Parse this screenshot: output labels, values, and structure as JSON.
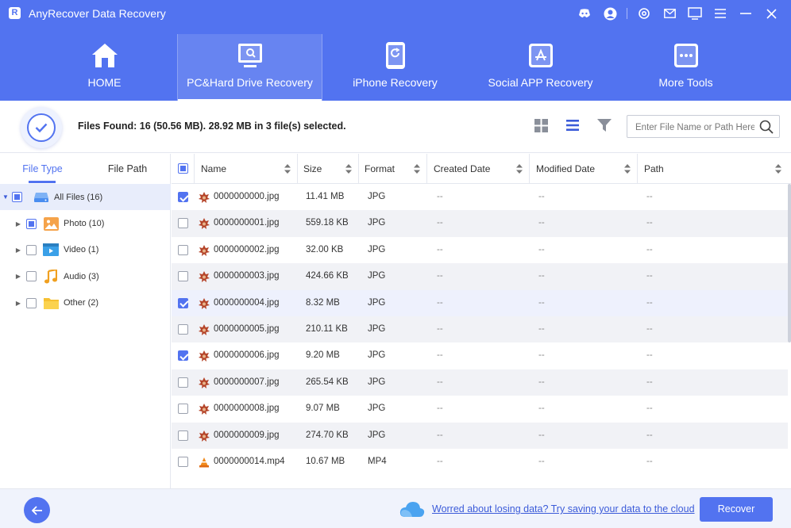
{
  "app": {
    "title": "AnyRecover Data Recovery",
    "logo_letter": "R",
    "accent_color": "#5273f0"
  },
  "titlebar_icons": [
    "discord-icon",
    "account-icon",
    "settings-icon",
    "mail-icon",
    "feedback-icon",
    "menu-icon",
    "minimize-icon",
    "close-icon"
  ],
  "nav": {
    "tabs": [
      {
        "label": "HOME",
        "icon": "home-icon",
        "active": false
      },
      {
        "label": "PC&Hard Drive Recovery",
        "icon": "pc-recovery-icon",
        "active": true
      },
      {
        "label": "iPhone Recovery",
        "icon": "iphone-icon",
        "active": false
      },
      {
        "label": "Social APP Recovery",
        "icon": "app-store-icon",
        "active": false
      },
      {
        "label": "More Tools",
        "icon": "more-tools-icon",
        "active": false
      }
    ]
  },
  "status": {
    "text": "Files Found: 16 (50.56 MB). 28.92 MB in 3 file(s) selected."
  },
  "search": {
    "placeholder": "Enter File Name or Path Here",
    "value": ""
  },
  "left_panel": {
    "tabs": [
      {
        "label": "File Type",
        "active": true
      },
      {
        "label": "File Path",
        "active": false
      }
    ],
    "tree": [
      {
        "label": "All Files (16)",
        "icon": "drive-icon",
        "state": "partial",
        "expanded": true,
        "level": 0
      },
      {
        "label": "Photo (10)",
        "icon": "photo-icon",
        "state": "partial",
        "expanded": false,
        "level": 1
      },
      {
        "label": "Video (1)",
        "icon": "video-icon",
        "state": "unchecked",
        "expanded": false,
        "level": 1
      },
      {
        "label": "Audio (3)",
        "icon": "audio-icon",
        "state": "unchecked",
        "expanded": false,
        "level": 1
      },
      {
        "label": "Other (2)",
        "icon": "folder-icon",
        "state": "unchecked",
        "expanded": false,
        "level": 1
      }
    ]
  },
  "table": {
    "header_checkbox_state": "partial",
    "columns": [
      "Name",
      "Size",
      "Format",
      "Created Date",
      "Modified Date",
      "Path"
    ],
    "rows": [
      {
        "checked": true,
        "name": "0000000000.jpg",
        "size": "11.41 MB",
        "format": "JPG",
        "created": "--",
        "modified": "--",
        "path": "--",
        "icon": "jpg-file-icon"
      },
      {
        "checked": false,
        "name": "0000000001.jpg",
        "size": "559.18 KB",
        "format": "JPG",
        "created": "--",
        "modified": "--",
        "path": "--",
        "icon": "jpg-file-icon"
      },
      {
        "checked": false,
        "name": "0000000002.jpg",
        "size": "32.00 KB",
        "format": "JPG",
        "created": "--",
        "modified": "--",
        "path": "--",
        "icon": "jpg-file-icon"
      },
      {
        "checked": false,
        "name": "0000000003.jpg",
        "size": "424.66 KB",
        "format": "JPG",
        "created": "--",
        "modified": "--",
        "path": "--",
        "icon": "jpg-file-icon"
      },
      {
        "checked": true,
        "name": "0000000004.jpg",
        "size": "8.32 MB",
        "format": "JPG",
        "created": "--",
        "modified": "--",
        "path": "--",
        "icon": "jpg-file-icon"
      },
      {
        "checked": false,
        "name": "0000000005.jpg",
        "size": "210.11 KB",
        "format": "JPG",
        "created": "--",
        "modified": "--",
        "path": "--",
        "icon": "jpg-file-icon"
      },
      {
        "checked": true,
        "name": "0000000006.jpg",
        "size": "9.20 MB",
        "format": "JPG",
        "created": "--",
        "modified": "--",
        "path": "--",
        "icon": "jpg-file-icon"
      },
      {
        "checked": false,
        "name": "0000000007.jpg",
        "size": "265.54 KB",
        "format": "JPG",
        "created": "--",
        "modified": "--",
        "path": "--",
        "icon": "jpg-file-icon"
      },
      {
        "checked": false,
        "name": "0000000008.jpg",
        "size": "9.07 MB",
        "format": "JPG",
        "created": "--",
        "modified": "--",
        "path": "--",
        "icon": "jpg-file-icon"
      },
      {
        "checked": false,
        "name": "0000000009.jpg",
        "size": "274.70 KB",
        "format": "JPG",
        "created": "--",
        "modified": "--",
        "path": "--",
        "icon": "jpg-file-icon"
      },
      {
        "checked": false,
        "name": "0000000014.mp4",
        "size": "10.67 MB",
        "format": "MP4",
        "created": "--",
        "modified": "--",
        "path": "--",
        "icon": "mp4-file-icon"
      }
    ]
  },
  "bottom": {
    "cloud_link": "Worred about losing data? Try saving your data to the cloud",
    "recover_label": "Recover"
  }
}
